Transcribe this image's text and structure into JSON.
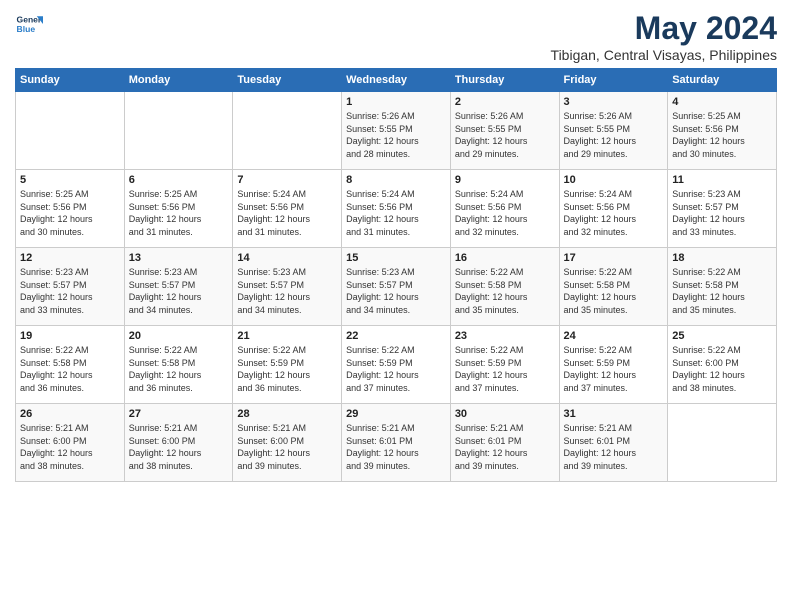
{
  "logo": {
    "name": "GeneralBlue",
    "line1": "General",
    "line2": "Blue"
  },
  "title": "May 2024",
  "subtitle": "Tibigan, Central Visayas, Philippines",
  "days_of_week": [
    "Sunday",
    "Monday",
    "Tuesday",
    "Wednesday",
    "Thursday",
    "Friday",
    "Saturday"
  ],
  "weeks": [
    [
      {
        "day": "",
        "info": ""
      },
      {
        "day": "",
        "info": ""
      },
      {
        "day": "",
        "info": ""
      },
      {
        "day": "1",
        "info": "Sunrise: 5:26 AM\nSunset: 5:55 PM\nDaylight: 12 hours\nand 28 minutes."
      },
      {
        "day": "2",
        "info": "Sunrise: 5:26 AM\nSunset: 5:55 PM\nDaylight: 12 hours\nand 29 minutes."
      },
      {
        "day": "3",
        "info": "Sunrise: 5:26 AM\nSunset: 5:55 PM\nDaylight: 12 hours\nand 29 minutes."
      },
      {
        "day": "4",
        "info": "Sunrise: 5:25 AM\nSunset: 5:56 PM\nDaylight: 12 hours\nand 30 minutes."
      }
    ],
    [
      {
        "day": "5",
        "info": "Sunrise: 5:25 AM\nSunset: 5:56 PM\nDaylight: 12 hours\nand 30 minutes."
      },
      {
        "day": "6",
        "info": "Sunrise: 5:25 AM\nSunset: 5:56 PM\nDaylight: 12 hours\nand 31 minutes."
      },
      {
        "day": "7",
        "info": "Sunrise: 5:24 AM\nSunset: 5:56 PM\nDaylight: 12 hours\nand 31 minutes."
      },
      {
        "day": "8",
        "info": "Sunrise: 5:24 AM\nSunset: 5:56 PM\nDaylight: 12 hours\nand 31 minutes."
      },
      {
        "day": "9",
        "info": "Sunrise: 5:24 AM\nSunset: 5:56 PM\nDaylight: 12 hours\nand 32 minutes."
      },
      {
        "day": "10",
        "info": "Sunrise: 5:24 AM\nSunset: 5:56 PM\nDaylight: 12 hours\nand 32 minutes."
      },
      {
        "day": "11",
        "info": "Sunrise: 5:23 AM\nSunset: 5:57 PM\nDaylight: 12 hours\nand 33 minutes."
      }
    ],
    [
      {
        "day": "12",
        "info": "Sunrise: 5:23 AM\nSunset: 5:57 PM\nDaylight: 12 hours\nand 33 minutes."
      },
      {
        "day": "13",
        "info": "Sunrise: 5:23 AM\nSunset: 5:57 PM\nDaylight: 12 hours\nand 34 minutes."
      },
      {
        "day": "14",
        "info": "Sunrise: 5:23 AM\nSunset: 5:57 PM\nDaylight: 12 hours\nand 34 minutes."
      },
      {
        "day": "15",
        "info": "Sunrise: 5:23 AM\nSunset: 5:57 PM\nDaylight: 12 hours\nand 34 minutes."
      },
      {
        "day": "16",
        "info": "Sunrise: 5:22 AM\nSunset: 5:58 PM\nDaylight: 12 hours\nand 35 minutes."
      },
      {
        "day": "17",
        "info": "Sunrise: 5:22 AM\nSunset: 5:58 PM\nDaylight: 12 hours\nand 35 minutes."
      },
      {
        "day": "18",
        "info": "Sunrise: 5:22 AM\nSunset: 5:58 PM\nDaylight: 12 hours\nand 35 minutes."
      }
    ],
    [
      {
        "day": "19",
        "info": "Sunrise: 5:22 AM\nSunset: 5:58 PM\nDaylight: 12 hours\nand 36 minutes."
      },
      {
        "day": "20",
        "info": "Sunrise: 5:22 AM\nSunset: 5:58 PM\nDaylight: 12 hours\nand 36 minutes."
      },
      {
        "day": "21",
        "info": "Sunrise: 5:22 AM\nSunset: 5:59 PM\nDaylight: 12 hours\nand 36 minutes."
      },
      {
        "day": "22",
        "info": "Sunrise: 5:22 AM\nSunset: 5:59 PM\nDaylight: 12 hours\nand 37 minutes."
      },
      {
        "day": "23",
        "info": "Sunrise: 5:22 AM\nSunset: 5:59 PM\nDaylight: 12 hours\nand 37 minutes."
      },
      {
        "day": "24",
        "info": "Sunrise: 5:22 AM\nSunset: 5:59 PM\nDaylight: 12 hours\nand 37 minutes."
      },
      {
        "day": "25",
        "info": "Sunrise: 5:22 AM\nSunset: 6:00 PM\nDaylight: 12 hours\nand 38 minutes."
      }
    ],
    [
      {
        "day": "26",
        "info": "Sunrise: 5:21 AM\nSunset: 6:00 PM\nDaylight: 12 hours\nand 38 minutes."
      },
      {
        "day": "27",
        "info": "Sunrise: 5:21 AM\nSunset: 6:00 PM\nDaylight: 12 hours\nand 38 minutes."
      },
      {
        "day": "28",
        "info": "Sunrise: 5:21 AM\nSunset: 6:00 PM\nDaylight: 12 hours\nand 39 minutes."
      },
      {
        "day": "29",
        "info": "Sunrise: 5:21 AM\nSunset: 6:01 PM\nDaylight: 12 hours\nand 39 minutes."
      },
      {
        "day": "30",
        "info": "Sunrise: 5:21 AM\nSunset: 6:01 PM\nDaylight: 12 hours\nand 39 minutes."
      },
      {
        "day": "31",
        "info": "Sunrise: 5:21 AM\nSunset: 6:01 PM\nDaylight: 12 hours\nand 39 minutes."
      },
      {
        "day": "",
        "info": ""
      }
    ]
  ]
}
